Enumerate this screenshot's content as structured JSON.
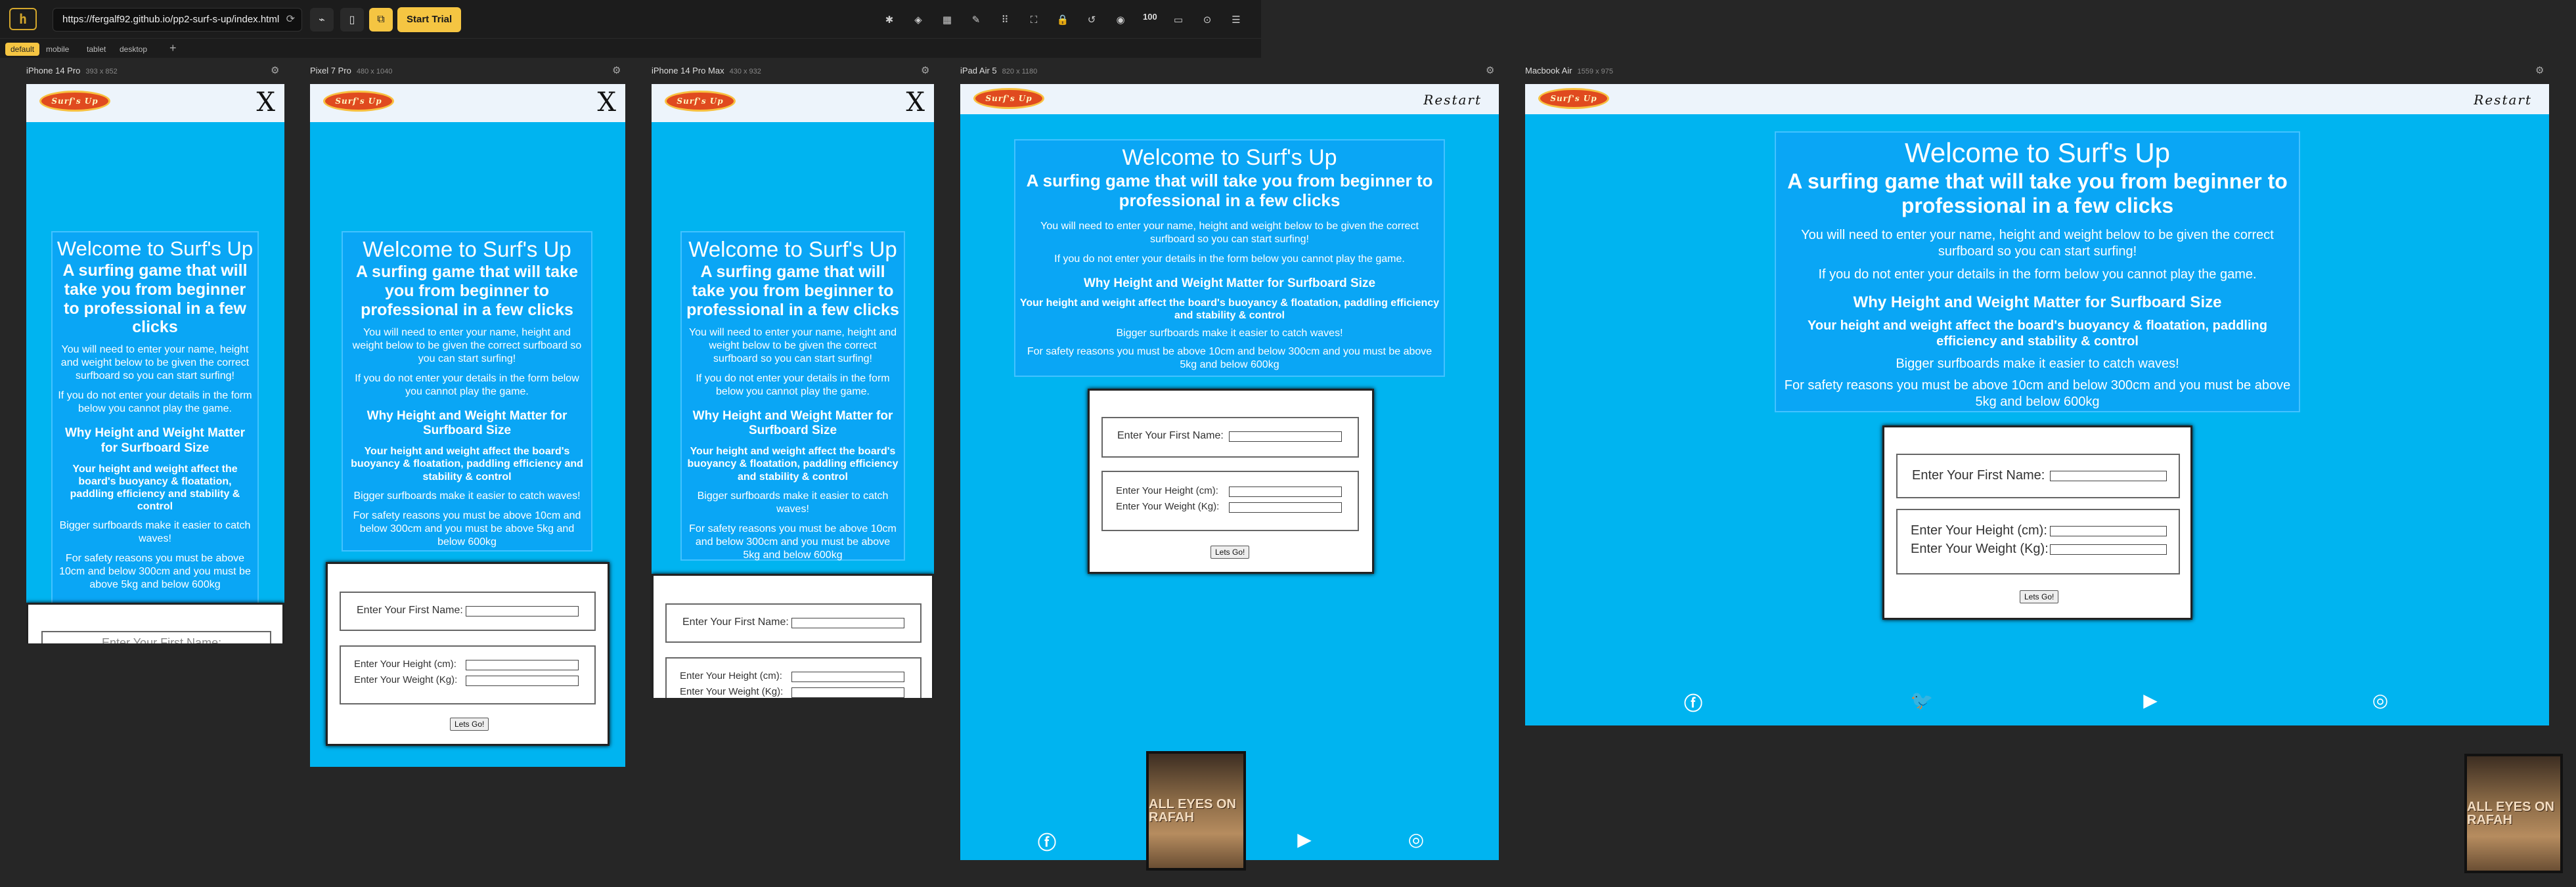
{
  "toolbar": {
    "url": "https://fergalf92.github.io/pp2-surf-s-up/index.html",
    "trial_label": "Start Trial",
    "zoom": "100"
  },
  "tabs": [
    "default",
    "mobile",
    "tablet",
    "desktop"
  ],
  "devices": [
    {
      "name": "iPhone 14 Pro",
      "size": "393 x 852"
    },
    {
      "name": "Pixel 7 Pro",
      "size": "480 x 1040"
    },
    {
      "name": "iPhone 14 Pro Max",
      "size": "430 x 932"
    },
    {
      "name": "iPad Air 5",
      "size": "820 x 1180"
    },
    {
      "name": "Macbook Air",
      "size": "1559 x 975"
    }
  ],
  "site": {
    "brand": "Surf's Up",
    "close_label": "X",
    "restart_label": "Restart",
    "title": "Welcome to Surf's Up",
    "subtitle": "A surfing game that will take you from beginner to professional in a few clicks",
    "intro": "You will need to enter your name, height and weight below to be given the correct surfboard so you can start surfing!",
    "warning": "If you do not enter your details in the form below you cannot play the game.",
    "why_heading": "Why Height and Weight Matter for Surfboard Size",
    "why_body": "Your height and weight affect the board's buoyancy & floatation, paddling efficiency and stability & control",
    "bigger": "Bigger surfboards make it easier to catch waves!",
    "safety": "For safety reasons you must be above 10cm and below 300cm and you must be above 5kg and below 600kg",
    "first_name_label": "Enter Your First Name:",
    "height_label": "Enter Your Height (cm):",
    "weight_label": "Enter Your Weight (Kg):",
    "go_label": "Lets Go!"
  },
  "thumbnail": {
    "text": "ALL EYES ON RAFAH"
  }
}
